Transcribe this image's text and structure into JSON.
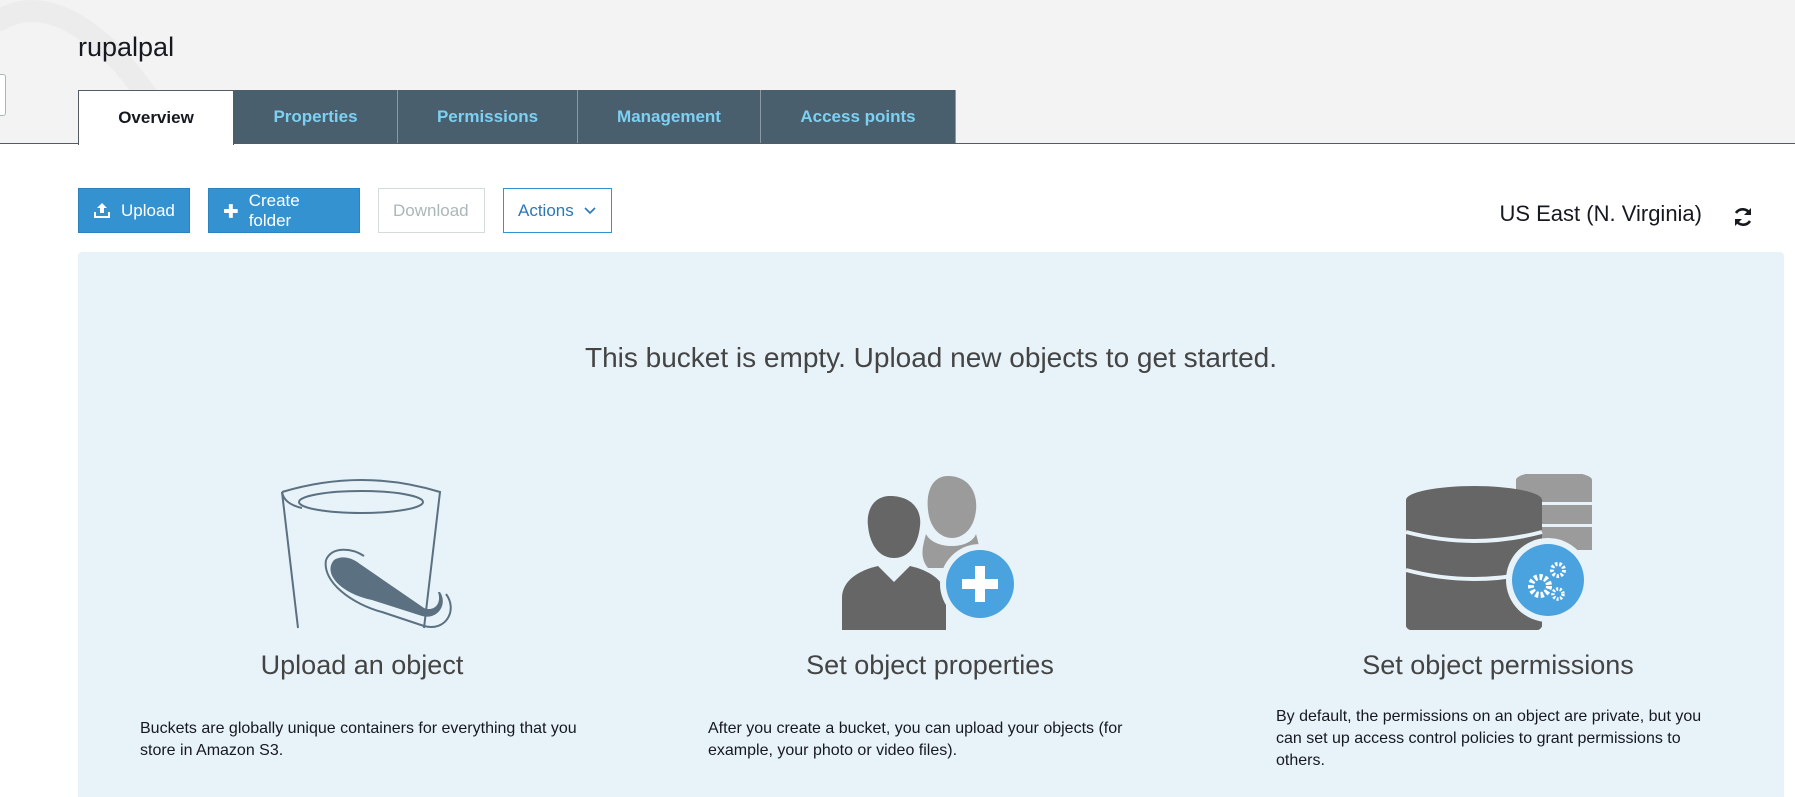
{
  "bucket": {
    "name": "rupalpal"
  },
  "tabs": [
    {
      "label": "Overview",
      "active": true
    },
    {
      "label": "Properties",
      "active": false
    },
    {
      "label": "Permissions",
      "active": false
    },
    {
      "label": "Management",
      "active": false
    },
    {
      "label": "Access points",
      "active": false
    }
  ],
  "toolbar": {
    "upload_label": "Upload",
    "upload_icon": "upload-icon",
    "create_folder_label": "Create folder",
    "create_folder_icon": "plus-icon",
    "download_label": "Download",
    "actions_label": "Actions",
    "actions_icon": "chevron-down-icon"
  },
  "region": {
    "label": "US East (N. Virginia)",
    "refresh_icon": "refresh-icon"
  },
  "empty_state": {
    "message": "This bucket is empty. Upload new objects to get started.",
    "cards": [
      {
        "icon": "bucket-icon",
        "title": "Upload an object",
        "description": "Buckets are globally unique containers for everything that you store in Amazon S3."
      },
      {
        "icon": "users-add-icon",
        "title": "Set object properties",
        "description": "After you create a bucket, you can upload your objects (for example, your photo or video files)."
      },
      {
        "icon": "database-settings-icon",
        "title": "Set object permissions",
        "description": "By default, the permissions on an object are private, but you can set up access control policies to grant permissions to others."
      }
    ]
  },
  "colors": {
    "tab_bg": "#4a5f6e",
    "tab_text": "#7cd1f3",
    "primary_button": "#3592d0",
    "panel_bg": "#e8f3f9",
    "illustration_dark": "#666666",
    "illustration_accent": "#4aa3df"
  }
}
